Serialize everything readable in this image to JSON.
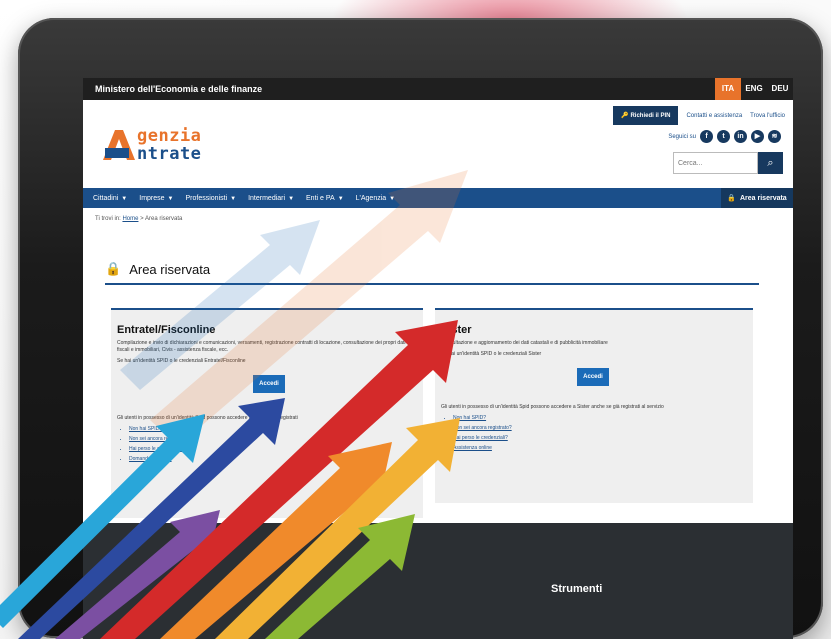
{
  "topbar": {
    "ministry": "Ministero dell'Economia e delle finanze",
    "languages": [
      "ITA",
      "ENG",
      "DEU"
    ],
    "active_language": "ITA"
  },
  "header": {
    "logo": {
      "line1": "genzia",
      "line2": "ntrate"
    },
    "util_nav": {
      "button": "Richiedi il PIN",
      "link1": "Contatti e assistenza",
      "link2": "Trova l'ufficio"
    },
    "social_label": "Seguici su",
    "social_icons": [
      "facebook-icon",
      "twitter-icon",
      "linkedin-icon",
      "youtube-icon",
      "rss-icon"
    ],
    "search_placeholder": "Cerca..."
  },
  "main_nav": {
    "items": [
      "Cittadini",
      "Imprese",
      "Professionisti",
      "Intermediari",
      "Enti e PA",
      "L'Agenzia"
    ],
    "area_button": "Area riservata"
  },
  "breadcrumb": {
    "prefix": "Ti trovi in:",
    "home": "Home",
    "current": "Area riservata"
  },
  "page_title": "Area riservata",
  "cards": [
    {
      "title": "Entratel/Fisconline",
      "desc": "Compilazione e invio di dichiarazioni e comunicazioni, versamenti, registrazione contratti di locazione, consultazione dei propri dati fiscali e immobiliari, Civis - assistenza fiscale, ecc.",
      "spid_text": "Se hai un'identità SPID o le credenziali Entratel/Fisconline",
      "button": "Accedi",
      "note": "Gli utenti in possesso di un'identità Spid possono accedere anche se già registrati",
      "links": [
        "Non hai SPID?",
        "Non sei ancora registrato?",
        "Hai perso le credenziali?",
        "Domande frequenti"
      ]
    },
    {
      "title": "Sister",
      "desc": "Consultazione e aggiornamento dei dati catastali e di pubblicità immobiliare",
      "spid_text": "Se hai un'identità SPID o le credenziali Sister",
      "button": "Accedi",
      "note": "Gli utenti in possesso di un'identità Spid possono accedere a Sister anche se già registrati al servizio",
      "links": [
        "Non hai SPID?",
        "Non sei ancora registrato?",
        "Hai perso le credenziali?",
        "Assistenza online"
      ]
    }
  ],
  "footer": {
    "strumenti": "Strumenti"
  }
}
